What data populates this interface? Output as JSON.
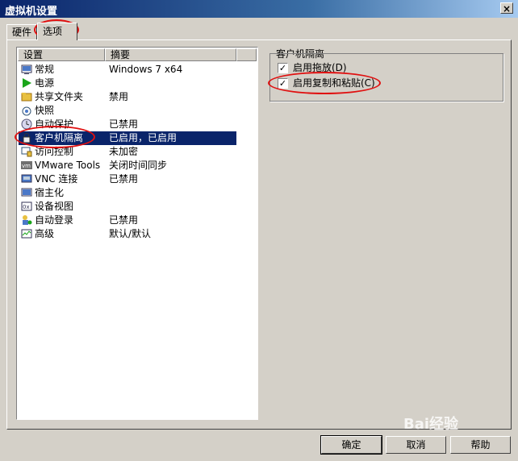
{
  "window": {
    "title": "虚拟机设置",
    "close_glyph": "×"
  },
  "tabs": [
    {
      "label": "硬件",
      "active": false
    },
    {
      "label": "选项",
      "active": true
    }
  ],
  "list": {
    "columns": [
      "设置",
      "摘要"
    ],
    "rows": [
      {
        "name": "常规",
        "summary": "Windows 7 x64",
        "icon": "general-icon",
        "selected": false
      },
      {
        "name": "电源",
        "summary": "",
        "icon": "power-play-icon",
        "selected": false
      },
      {
        "name": "共享文件夹",
        "summary": "禁用",
        "icon": "shared-folder-icon",
        "selected": false
      },
      {
        "name": "快照",
        "summary": "",
        "icon": "snapshot-icon",
        "selected": false
      },
      {
        "name": "自动保护",
        "summary": "已禁用",
        "icon": "autoprotect-icon",
        "selected": false
      },
      {
        "name": "客户机隔离",
        "summary": "已启用，已启用",
        "icon": "lock-icon",
        "selected": true
      },
      {
        "name": "访问控制",
        "summary": "未加密",
        "icon": "access-control-icon",
        "selected": false
      },
      {
        "name": "VMware Tools",
        "summary": "关闭时间同步",
        "icon": "vmware-tools-icon",
        "selected": false
      },
      {
        "name": "VNC 连接",
        "summary": "已禁用",
        "icon": "vnc-icon",
        "selected": false
      },
      {
        "name": "宿主化",
        "summary": "",
        "icon": "host-icon",
        "selected": false
      },
      {
        "name": "设备视图",
        "summary": "",
        "icon": "device-view-icon",
        "selected": false
      },
      {
        "name": "自动登录",
        "summary": "已禁用",
        "icon": "autologon-icon",
        "selected": false
      },
      {
        "name": "高级",
        "summary": "默认/默认",
        "icon": "advanced-icon",
        "selected": false
      }
    ]
  },
  "isolation": {
    "group_label": "客户机隔离",
    "options": [
      {
        "label": "启用拖放(D)",
        "checked": true
      },
      {
        "label": "启用复制和粘贴(C)",
        "checked": true
      }
    ]
  },
  "buttons": {
    "ok": "确定",
    "cancel": "取消",
    "help": "帮助"
  },
  "watermark": "Bai经验",
  "colors": {
    "selection": "#0a246a",
    "annotation": "#e01010",
    "dialog_bg": "#d4d0c8"
  }
}
